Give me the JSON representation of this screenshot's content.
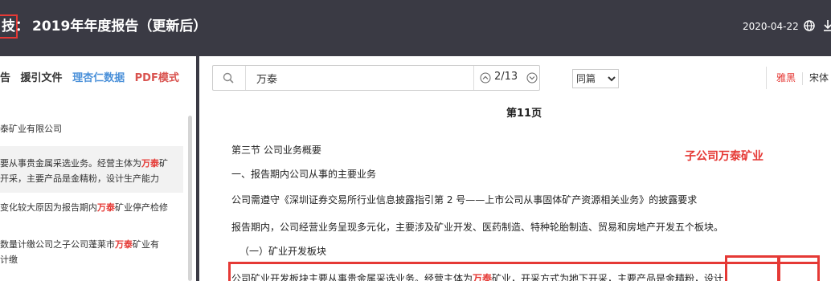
{
  "header": {
    "title_prefix": "技：",
    "title": "2019年年度报告（更新后）",
    "date": "2020-04-22"
  },
  "left_panel": {
    "tabs": [
      {
        "label": "告"
      },
      {
        "label": "援引文件"
      },
      {
        "label": "理杏仁数据"
      },
      {
        "label": "PDF模式"
      }
    ],
    "items": [
      {
        "text": "泰矿业有限公司"
      },
      {
        "line1_pre": "要从事贵金属采选业务。经营主体为",
        "line1_hl": "万泰",
        "line1_post": "矿",
        "line2": "开采，主要产品是金精粉，设计生产能力"
      },
      {
        "pre": "变化较大原因为报告期内",
        "hl": "万泰",
        "post": "矿业停产检修"
      },
      {
        "line1_pre": "数量计缴公司之子公司蓬莱市",
        "line1_hl": "万泰",
        "line1_post": "矿业有",
        "line2": "计缴"
      }
    ]
  },
  "toolbar": {
    "search_value": "万泰",
    "match_count": "2/13",
    "scope_selected": "同篇",
    "font_yahei": "雅黑",
    "font_song": "宋体"
  },
  "document": {
    "page_label": "第11页",
    "annotation": "子公司万泰矿业",
    "lines": [
      "第三节 公司业务概要",
      "一、报告期内公司从事的主要业务",
      "公司需遵守《深圳证券交易所行业信息披露指引第 2 号——上市公司从事固体矿产资源相关业务》的披露要求",
      "报告期内，公司经营业务呈现多元化，主要涉及矿业开发、医药制造、特种轮胎制造、贸易和房地产开发五个板块。",
      "（一）矿业开发板块"
    ],
    "last_line": {
      "pre": "公司矿业开发板块主要从事贵金属采选业务。经营主体为",
      "hl": "万泰",
      "post": "矿业，开采方式为地下开采，主要产品是金精粉，设计"
    }
  }
}
